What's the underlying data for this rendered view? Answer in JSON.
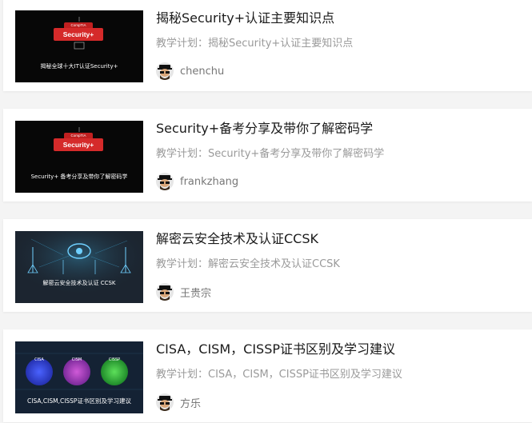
{
  "courses": [
    {
      "title": "揭秘Security+认证主要知识点",
      "plan": "教学计划：揭秘Security+认证主要知识点",
      "author": "chenchu",
      "thumb": {
        "brand": "CompTIA",
        "badge": "Security+",
        "caption": "揭秘全球十大IT认证Security+"
      }
    },
    {
      "title": "Security+备考分享及带你了解密码学",
      "plan": "教学计划：Security+备考分享及带你了解密码学",
      "author": "frankzhang",
      "thumb": {
        "brand": "CompTIA",
        "badge": "Security+",
        "caption": "Security+ 备考分享及带你了解密码学"
      }
    },
    {
      "title": "解密云安全技术及认证CCSK",
      "plan": "教学计划：解密云安全技术及认证CCSK",
      "author": "王贵宗",
      "thumb": {
        "caption": "解密云安全技术及认证 CCSK"
      }
    },
    {
      "title": "CISA，CISM，CISSP证书区别及学习建议",
      "plan": "教学计划：CISA，CISM，CISSP证书区别及学习建议",
      "author": "方乐",
      "thumb": {
        "labels": [
          "CISA",
          "CISM",
          "CISSP"
        ],
        "caption": "CISA,CISM,CISSP证书区别及学习建议"
      }
    }
  ],
  "colors": {
    "badge_red": "#d52a2a",
    "title": "#1a1a1a",
    "meta": "#9a9a9a"
  }
}
